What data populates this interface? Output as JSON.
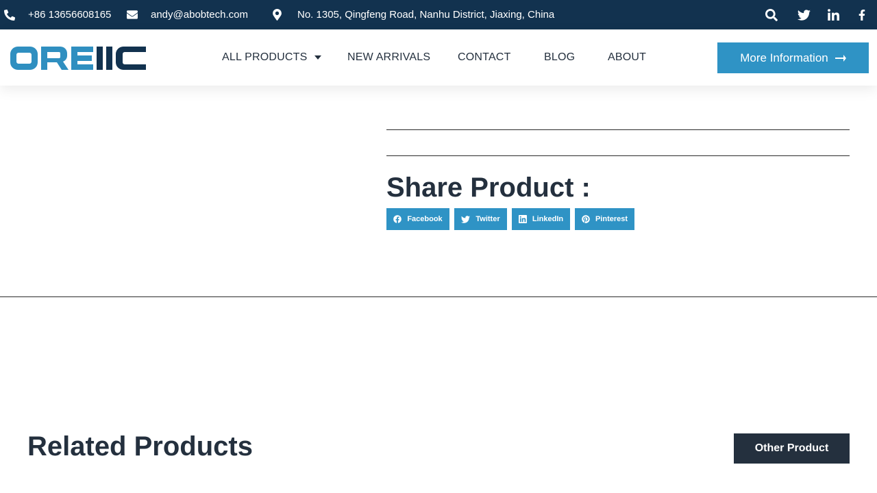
{
  "topbar": {
    "phone": "+86 13656608165",
    "email": "andy@abobtech.com",
    "address": "No. 1305, Qingfeng Road, Nanhu District, Jiaxing, China",
    "icons": [
      "phone-icon",
      "envelope-icon",
      "map-marker-icon",
      "search-icon",
      "twitter-icon",
      "linkedin-icon",
      "facebook-icon"
    ]
  },
  "header": {
    "logo_text": "OREIIC",
    "brand_colors": {
      "light": "#2f8fc0",
      "dark": "#12324f"
    },
    "nav": [
      {
        "label": "ALL PRODUCTS",
        "has_dropdown": true
      },
      {
        "label": "NEW ARRIVALS"
      },
      {
        "label": "CONTACT"
      },
      {
        "label": "BLOG"
      },
      {
        "label": "ABOUT"
      }
    ],
    "cta_label": "More Information"
  },
  "share": {
    "title": "Share Product :",
    "buttons": [
      {
        "label": "Facebook",
        "icon": "facebook-icon"
      },
      {
        "label": "Twitter",
        "icon": "twitter-icon"
      },
      {
        "label": "LinkedIn",
        "icon": "linkedin-icon"
      },
      {
        "label": "Pinterest",
        "icon": "pinterest-icon"
      }
    ]
  },
  "related": {
    "title": "Related Products",
    "other_button": "Other Product"
  },
  "colors": {
    "topbar": "#12324f",
    "accent": "#2f93c5",
    "dark": "#24303e"
  }
}
